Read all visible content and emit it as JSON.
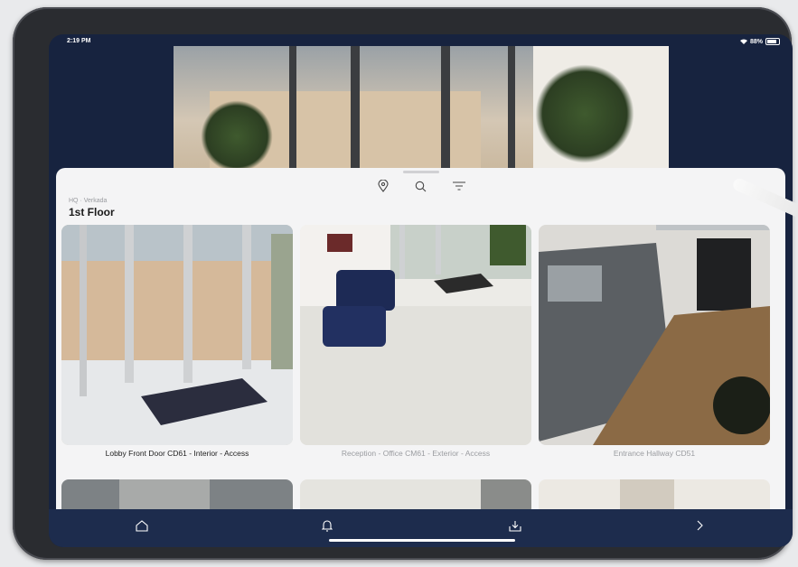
{
  "status": {
    "time": "2:19 PM",
    "battery": "88%"
  },
  "sheet": {
    "breadcrumb": "HQ · Verkada",
    "title": "1st Floor"
  },
  "cameras": [
    {
      "name": "Lobby Front Door CD61 - Interior - Access",
      "state": "active"
    },
    {
      "name": "Reception - Office CM61 - Exterior - Access",
      "state": "muted"
    },
    {
      "name": "Entrance Hallway CD51",
      "state": "muted"
    }
  ],
  "icons": {
    "location": "location-pin-icon",
    "search": "search-icon",
    "filter": "filter-icon",
    "home": "home-icon",
    "alerts": "bell-icon",
    "download": "download-icon",
    "forward": "chevron-right-icon"
  },
  "colors": {
    "navy": "#17233f",
    "tabbar": "#1d2c4d",
    "sheet": "#f4f4f5"
  }
}
